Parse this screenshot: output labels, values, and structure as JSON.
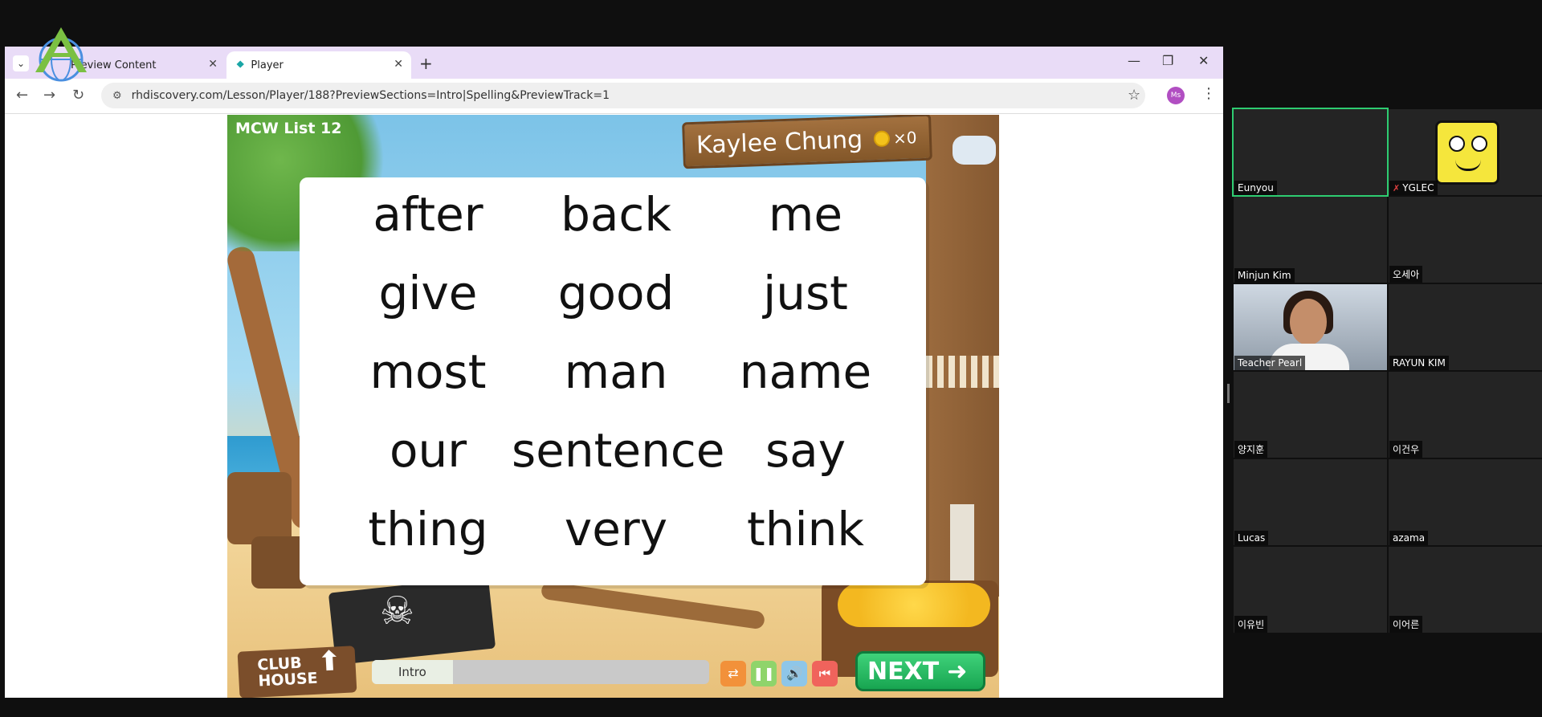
{
  "browser": {
    "tabs": [
      {
        "label": "Preview Content"
      },
      {
        "label": "Player"
      }
    ],
    "new_tab": "+",
    "window_controls": {
      "minimize": "—",
      "restore": "❐",
      "close": "✕"
    },
    "url": "rhdiscovery.com/Lesson/Player/188?PreviewSections=Intro|Spelling&PreviewTrack=1",
    "profile_initials": "Ms"
  },
  "lesson": {
    "list_title": "MCW List 12",
    "student_name": "Kaylee Chung",
    "coins": "×0",
    "words": [
      [
        "after",
        "back",
        "me"
      ],
      [
        "give",
        "good",
        "just"
      ],
      [
        "most",
        "man",
        "name"
      ],
      [
        "our",
        "sentence",
        "say"
      ],
      [
        "thing",
        "very",
        "think"
      ]
    ],
    "club_house": {
      "line1": "CLUB",
      "line2": "HOUSE"
    },
    "progress": {
      "section": "Intro",
      "fraction": 0.24
    },
    "next_label": "NEXT",
    "controls": [
      "shuffle-icon",
      "pause-icon",
      "speaker-icon",
      "restart-icon"
    ]
  },
  "gallery": {
    "participants": [
      {
        "name": "Eunyou",
        "active": true
      },
      {
        "name": "YGLEC",
        "muted": true
      },
      {
        "name": "Minjun Kim"
      },
      {
        "name": "오세아"
      },
      {
        "name": "Teacher Pearl"
      },
      {
        "name": "RAYUN KIM"
      },
      {
        "name": "양지훈"
      },
      {
        "name": "이건우"
      },
      {
        "name": "Lucas"
      },
      {
        "name": "azama"
      },
      {
        "name": "이유빈"
      },
      {
        "name": "이어른"
      }
    ]
  },
  "colors": {
    "tab_strip": "#e9dcf7",
    "next_green": "#18a551",
    "active_speaker": "#2ecc71"
  }
}
